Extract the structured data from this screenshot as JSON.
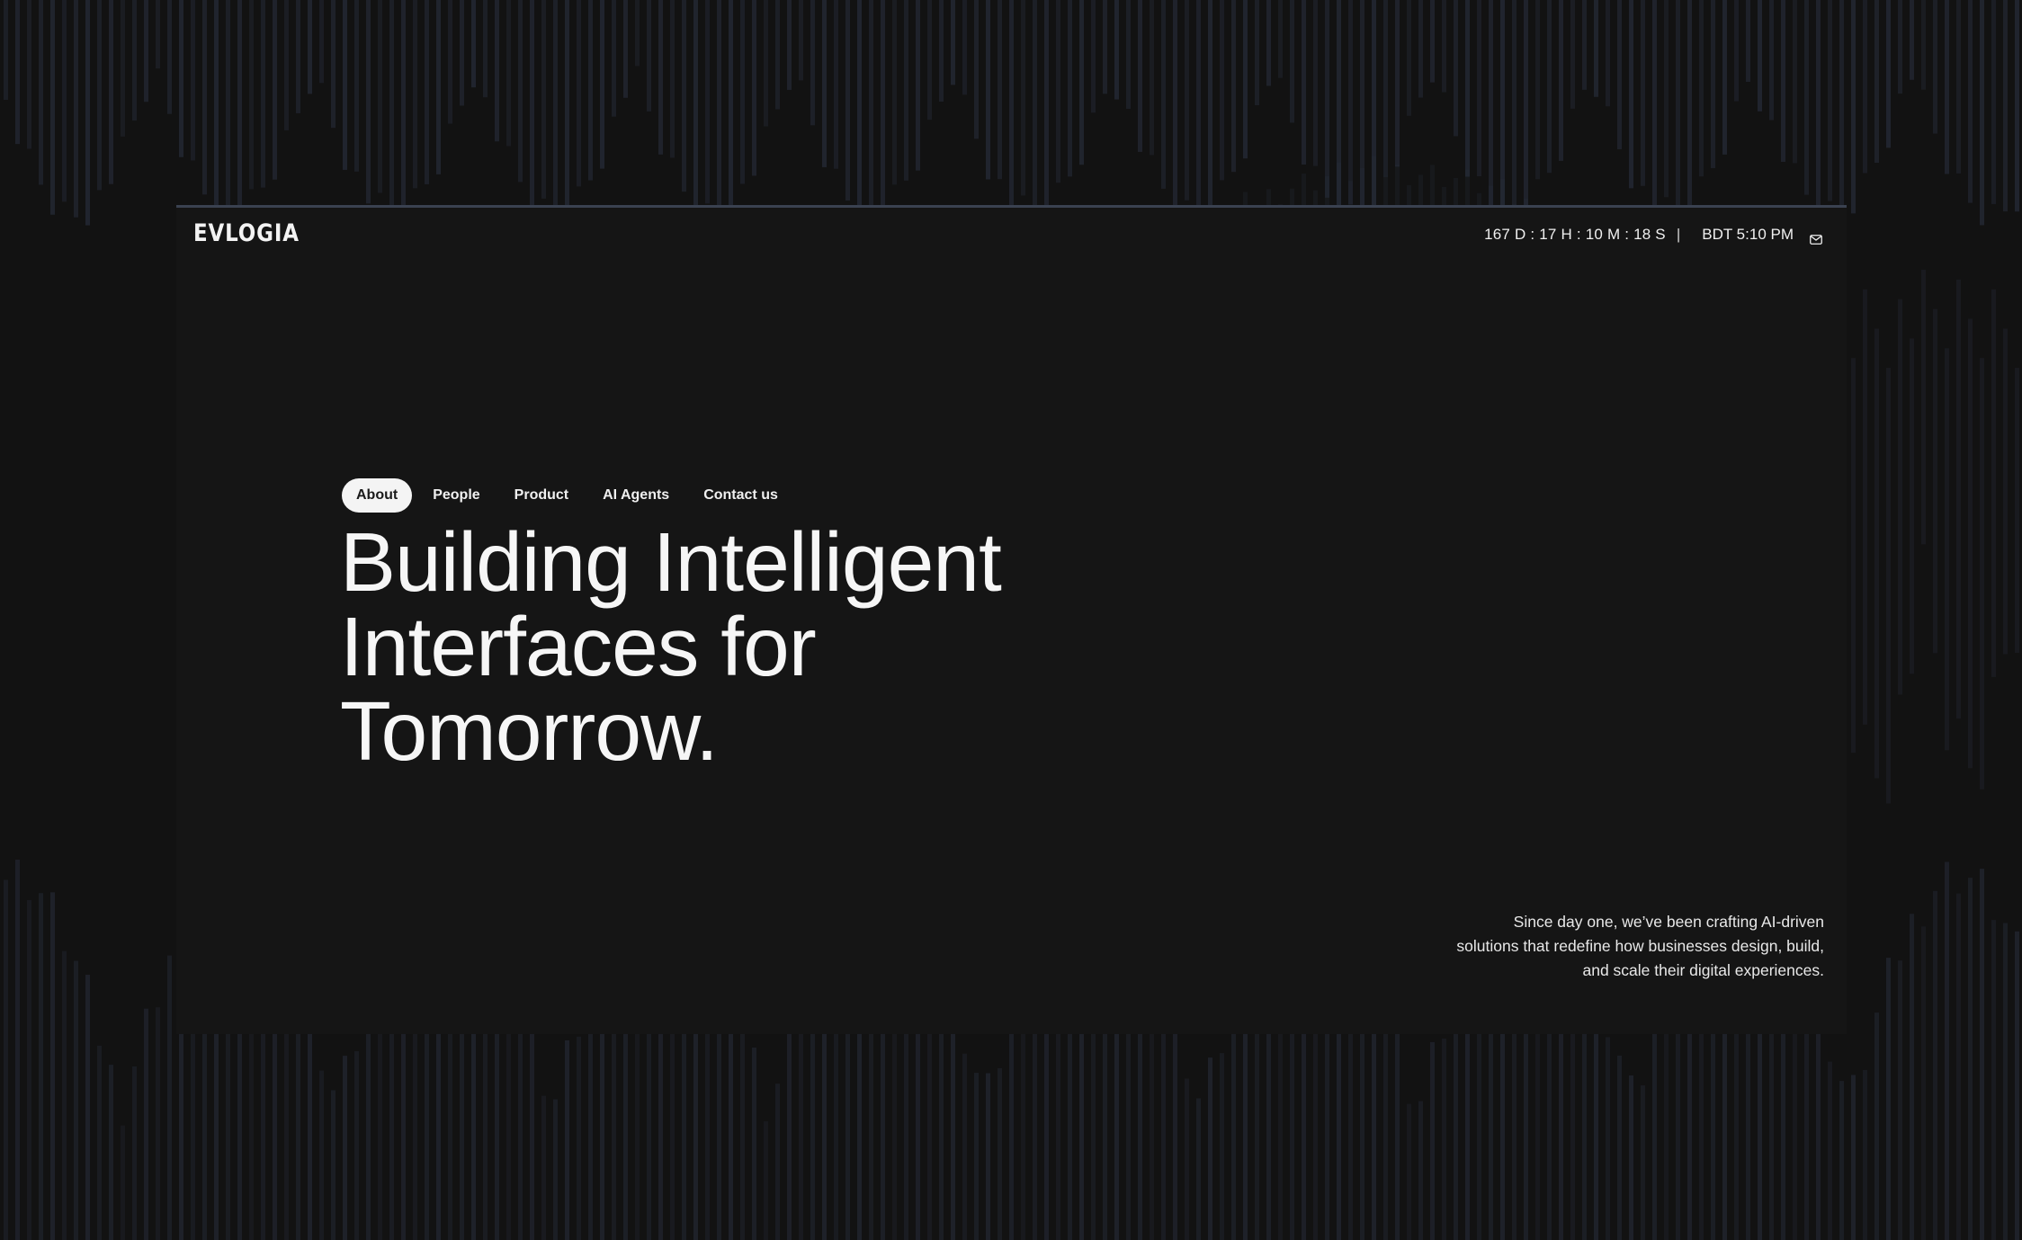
{
  "brand": {
    "logo_text": "EVLOGIA"
  },
  "topbar": {
    "countdown": "167 D : 17 H : 10 M : 18 S",
    "separator": "|",
    "local_time": "BDT 5:10 PM",
    "mail_icon": "envelope-icon"
  },
  "nav": {
    "items": [
      {
        "label": "About",
        "active": true
      },
      {
        "label": "People",
        "active": false
      },
      {
        "label": "Product",
        "active": false
      },
      {
        "label": "AI Agents",
        "active": false
      },
      {
        "label": "Contact us",
        "active": false
      }
    ]
  },
  "hero": {
    "headline_lines": [
      "Building Intelligent",
      "Interfaces for",
      "Tomorrow."
    ],
    "tagline_lines": [
      "Since day one, we’ve been crafting AI-driven",
      "solutions that redefine how businesses design, build,",
      "and scale their digital experiences."
    ]
  },
  "colors": {
    "background": "#121212",
    "frame_border": "#3a4150",
    "bar_color": "#2a3040",
    "text": "#f2f2f2",
    "active_pill": "#f4f4f4"
  }
}
